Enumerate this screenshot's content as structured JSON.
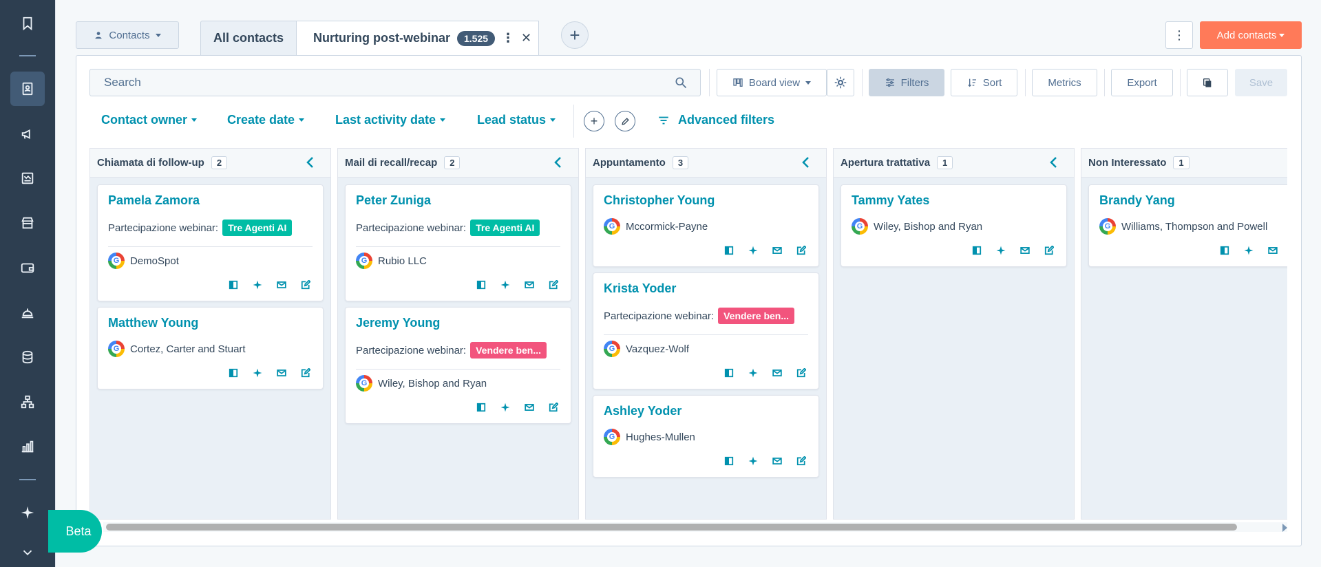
{
  "nav": {
    "icons": [
      "bookmark-icon",
      "contacts-book-icon",
      "megaphone-icon",
      "newsletter-icon",
      "store-icon",
      "wallet-icon",
      "service-bell-icon",
      "database-icon",
      "hierarchy-icon",
      "bar-chart-icon",
      "sparkle-icon",
      "chevron-down-icon"
    ],
    "active": "contacts-book-icon"
  },
  "header": {
    "object_selector": "Contacts",
    "tabs": [
      {
        "label": "All contacts"
      },
      {
        "label": "Nurturing post-webinar",
        "count": "1.525"
      }
    ],
    "add_contacts": "Add contacts"
  },
  "toolbar": {
    "search_placeholder": "Search",
    "board_view": "Board view",
    "filters": "Filters",
    "sort": "Sort",
    "metrics": "Metrics",
    "export": "Export",
    "save": "Save"
  },
  "filter_row": {
    "items": [
      "Contact owner",
      "Create date",
      "Last activity date",
      "Lead status"
    ],
    "advanced": "Advanced filters"
  },
  "colors": {
    "accent": "#0091ae",
    "primary_cta": "#ff7a59",
    "tag_green": "#00bda5",
    "tag_pink": "#f2547d",
    "nav_bg": "#2d3e50"
  },
  "board": {
    "prop_label": "Partecipazione webinar:",
    "columns": [
      {
        "title": "Chiamata di follow-up",
        "count": "2",
        "cards": [
          {
            "name": "Pamela Zamora",
            "tag": "Tre Agenti AI",
            "tag_color": "green",
            "company": "DemoSpot"
          },
          {
            "name": "Matthew Young",
            "tag": "",
            "tag_color": "",
            "company": "Cortez, Carter and Stuart"
          }
        ]
      },
      {
        "title": "Mail di recall/recap",
        "count": "2",
        "cards": [
          {
            "name": "Peter Zuniga",
            "tag": "Tre Agenti AI",
            "tag_color": "green",
            "company": "Rubio LLC"
          },
          {
            "name": "Jeremy Young",
            "tag": "Vendere ben...",
            "tag_color": "pink",
            "company": "Wiley, Bishop and Ryan"
          }
        ]
      },
      {
        "title": "Appuntamento",
        "count": "3",
        "cards": [
          {
            "name": "Christopher Young",
            "tag": "",
            "tag_color": "",
            "company": "Mccormick-Payne"
          },
          {
            "name": "Krista Yoder",
            "tag": "Vendere ben...",
            "tag_color": "pink",
            "company": "Vazquez-Wolf"
          },
          {
            "name": "Ashley Yoder",
            "tag": "",
            "tag_color": "",
            "company": "Hughes-Mullen"
          }
        ]
      },
      {
        "title": "Apertura trattativa",
        "count": "1",
        "cards": [
          {
            "name": "Tammy Yates",
            "tag": "",
            "tag_color": "",
            "company": "Wiley, Bishop and Ryan"
          }
        ]
      },
      {
        "title": "Non Interessato",
        "count": "1",
        "cards": [
          {
            "name": "Brandy Yang",
            "tag": "",
            "tag_color": "",
            "company": "Williams, Thompson and Powell"
          }
        ]
      }
    ]
  },
  "beta_label": "Beta"
}
